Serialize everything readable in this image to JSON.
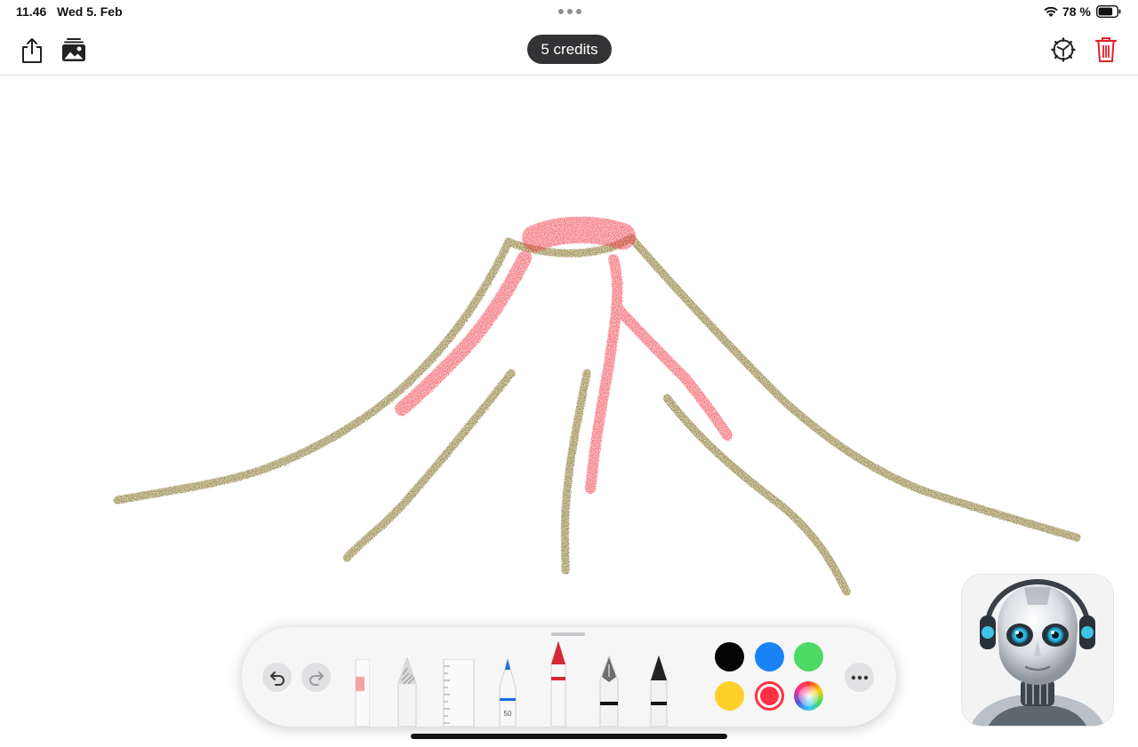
{
  "status_bar": {
    "time": "11.46",
    "date": "Wed 5. Feb",
    "battery": "78 %"
  },
  "toolbar": {
    "credits": "5 credits"
  },
  "palette": {
    "pencil_width_label": "50",
    "colors": {
      "black": "#050505",
      "blue": "#1a82f7",
      "green": "#4cd964",
      "yellow": "#ffd02b",
      "red": "#ff3045"
    },
    "selected_color": "red"
  },
  "drawing": {
    "stroke_colors": {
      "mountain": "#7e6b1f",
      "lava": "#f0323f"
    }
  },
  "icons": [
    "share-icon",
    "photo-gallery-icon",
    "settings-icon",
    "trash-icon",
    "undo-icon",
    "redo-icon",
    "more-icon"
  ]
}
